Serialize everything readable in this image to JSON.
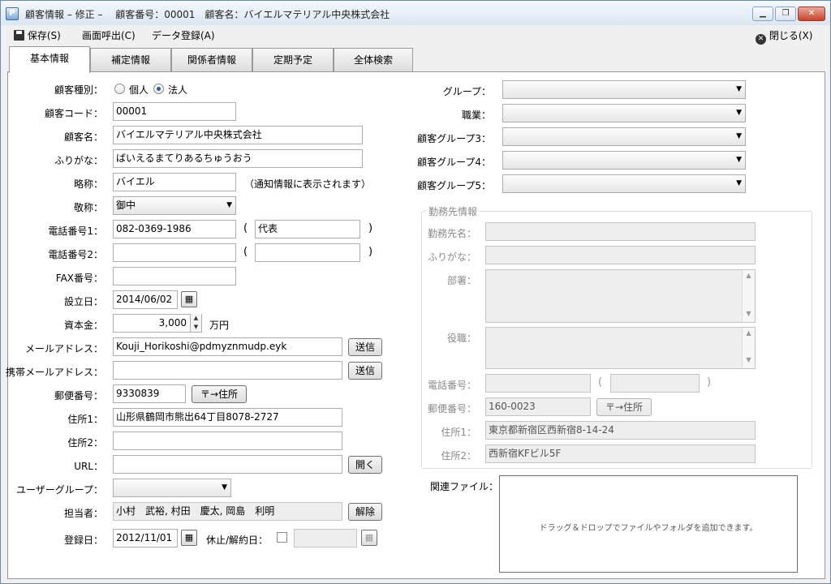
{
  "window": {
    "title": "顧客情報 – 修正 –　 顧客番号：00001　顧客名：バイエルマテリアル中央株式会社",
    "minimize": "▁",
    "maximize": "❐",
    "close": "✕"
  },
  "menu": {
    "save": "保存(S)",
    "recall": "画面呼出(C)",
    "data_register": "データ登録(A)",
    "close": "閉じる(X)"
  },
  "tabs": [
    "基本情報",
    "補定情報",
    "関係者情報",
    "定期予定",
    "全体検索"
  ],
  "form": {
    "customer_type_label": "顧客種別：",
    "customer_type_options": [
      "個人",
      "法人"
    ],
    "customer_type_selected": "法人",
    "customer_code_label": "顧客コード：",
    "customer_code": "00001",
    "customer_name_label": "顧客名：",
    "customer_name": "バイエルマテリアル中央株式会社",
    "furigana_label": "ふりがな：",
    "furigana": "ばいえるまてりあるちゅうおう",
    "short_name_label": "略称：",
    "short_name": "バイエル",
    "short_name_note": "（通知情報に表示されます）",
    "honorific_label": "敬称：",
    "honorific": "御中",
    "phone1_label": "電話番号1：",
    "phone1": "082-0369-1986",
    "phone1_note": "代表",
    "phone2_label": "電話番号2：",
    "phone2": "",
    "phone2_note": "",
    "fax_label": "FAX番号：",
    "fax": "",
    "established_label": "設立日：",
    "established": "2014/06/02",
    "capital_label": "資本金：",
    "capital": "3,000",
    "capital_unit": "万円",
    "email_label": "メールアドレス：",
    "email": "Kouji_Horikoshi@pdmyznmudp.eyk",
    "send_button": "送信",
    "mobile_email_label": "携帯メールアドレス：",
    "mobile_email": "",
    "postal_label": "郵便番号：",
    "postal": "9330839",
    "postal_to_address_button": "〒→住所",
    "address1_label": "住所1：",
    "address1": "山形県鶴岡市熊出64丁目8078-2727",
    "address2_label": "住所2：",
    "address2": "",
    "url_label": "URL：",
    "url": "",
    "open_button": "開く",
    "user_group_label": "ユーザーグループ：",
    "user_group": "",
    "staff_label": "担当者：",
    "staff": "小村　武裕, 村田　慶太, 岡島　利明",
    "release_button": "解除",
    "registered_label": "登録日：",
    "registered": "2012/11/01",
    "suspended_label": "休止/解約日：",
    "suspended": ""
  },
  "right": {
    "group_label": "グループ：",
    "occupation_label": "職業：",
    "customer_group3_label": "顧客グループ3：",
    "customer_group4_label": "顧客グループ4：",
    "customer_group5_label": "顧客グループ5：",
    "workplace_legend": "勤務先情報",
    "workplace_name_label": "勤務先名：",
    "workplace_furigana_label": "ふりがな：",
    "department_label": "部署：",
    "position_label": "役職：",
    "wp_phone_label": "電話番号：",
    "wp_postal_label": "郵便番号：",
    "wp_postal": "160-0023",
    "wp_postal_button": "〒→住所",
    "wp_address1_label": "住所1：",
    "wp_address1": "東京都新宿区西新宿8-14-24",
    "wp_address2_label": "住所2：",
    "wp_address2": "西新宿KFビル5F",
    "related_files_label": "関連ファイル：",
    "drop_hint": "ドラッグ＆ドロップでファイルやフォルダを追加できます。"
  },
  "icons": {
    "save": "floppy-disk-icon",
    "close": "close-circle-icon",
    "calendar": "calendar-icon"
  }
}
